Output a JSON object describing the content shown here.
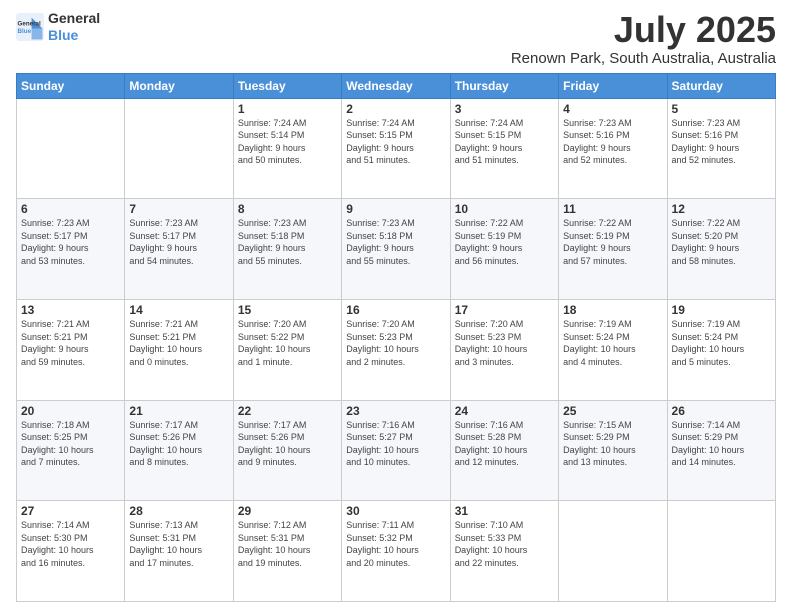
{
  "logo": {
    "line1": "General",
    "line2": "Blue"
  },
  "title": "July 2025",
  "subtitle": "Renown Park, South Australia, Australia",
  "days_of_week": [
    "Sunday",
    "Monday",
    "Tuesday",
    "Wednesday",
    "Thursday",
    "Friday",
    "Saturday"
  ],
  "weeks": [
    [
      {
        "day": "",
        "info": ""
      },
      {
        "day": "",
        "info": ""
      },
      {
        "day": "1",
        "info": "Sunrise: 7:24 AM\nSunset: 5:14 PM\nDaylight: 9 hours\nand 50 minutes."
      },
      {
        "day": "2",
        "info": "Sunrise: 7:24 AM\nSunset: 5:15 PM\nDaylight: 9 hours\nand 51 minutes."
      },
      {
        "day": "3",
        "info": "Sunrise: 7:24 AM\nSunset: 5:15 PM\nDaylight: 9 hours\nand 51 minutes."
      },
      {
        "day": "4",
        "info": "Sunrise: 7:23 AM\nSunset: 5:16 PM\nDaylight: 9 hours\nand 52 minutes."
      },
      {
        "day": "5",
        "info": "Sunrise: 7:23 AM\nSunset: 5:16 PM\nDaylight: 9 hours\nand 52 minutes."
      }
    ],
    [
      {
        "day": "6",
        "info": "Sunrise: 7:23 AM\nSunset: 5:17 PM\nDaylight: 9 hours\nand 53 minutes."
      },
      {
        "day": "7",
        "info": "Sunrise: 7:23 AM\nSunset: 5:17 PM\nDaylight: 9 hours\nand 54 minutes."
      },
      {
        "day": "8",
        "info": "Sunrise: 7:23 AM\nSunset: 5:18 PM\nDaylight: 9 hours\nand 55 minutes."
      },
      {
        "day": "9",
        "info": "Sunrise: 7:23 AM\nSunset: 5:18 PM\nDaylight: 9 hours\nand 55 minutes."
      },
      {
        "day": "10",
        "info": "Sunrise: 7:22 AM\nSunset: 5:19 PM\nDaylight: 9 hours\nand 56 minutes."
      },
      {
        "day": "11",
        "info": "Sunrise: 7:22 AM\nSunset: 5:19 PM\nDaylight: 9 hours\nand 57 minutes."
      },
      {
        "day": "12",
        "info": "Sunrise: 7:22 AM\nSunset: 5:20 PM\nDaylight: 9 hours\nand 58 minutes."
      }
    ],
    [
      {
        "day": "13",
        "info": "Sunrise: 7:21 AM\nSunset: 5:21 PM\nDaylight: 9 hours\nand 59 minutes."
      },
      {
        "day": "14",
        "info": "Sunrise: 7:21 AM\nSunset: 5:21 PM\nDaylight: 10 hours\nand 0 minutes."
      },
      {
        "day": "15",
        "info": "Sunrise: 7:20 AM\nSunset: 5:22 PM\nDaylight: 10 hours\nand 1 minute."
      },
      {
        "day": "16",
        "info": "Sunrise: 7:20 AM\nSunset: 5:23 PM\nDaylight: 10 hours\nand 2 minutes."
      },
      {
        "day": "17",
        "info": "Sunrise: 7:20 AM\nSunset: 5:23 PM\nDaylight: 10 hours\nand 3 minutes."
      },
      {
        "day": "18",
        "info": "Sunrise: 7:19 AM\nSunset: 5:24 PM\nDaylight: 10 hours\nand 4 minutes."
      },
      {
        "day": "19",
        "info": "Sunrise: 7:19 AM\nSunset: 5:24 PM\nDaylight: 10 hours\nand 5 minutes."
      }
    ],
    [
      {
        "day": "20",
        "info": "Sunrise: 7:18 AM\nSunset: 5:25 PM\nDaylight: 10 hours\nand 7 minutes."
      },
      {
        "day": "21",
        "info": "Sunrise: 7:17 AM\nSunset: 5:26 PM\nDaylight: 10 hours\nand 8 minutes."
      },
      {
        "day": "22",
        "info": "Sunrise: 7:17 AM\nSunset: 5:26 PM\nDaylight: 10 hours\nand 9 minutes."
      },
      {
        "day": "23",
        "info": "Sunrise: 7:16 AM\nSunset: 5:27 PM\nDaylight: 10 hours\nand 10 minutes."
      },
      {
        "day": "24",
        "info": "Sunrise: 7:16 AM\nSunset: 5:28 PM\nDaylight: 10 hours\nand 12 minutes."
      },
      {
        "day": "25",
        "info": "Sunrise: 7:15 AM\nSunset: 5:29 PM\nDaylight: 10 hours\nand 13 minutes."
      },
      {
        "day": "26",
        "info": "Sunrise: 7:14 AM\nSunset: 5:29 PM\nDaylight: 10 hours\nand 14 minutes."
      }
    ],
    [
      {
        "day": "27",
        "info": "Sunrise: 7:14 AM\nSunset: 5:30 PM\nDaylight: 10 hours\nand 16 minutes."
      },
      {
        "day": "28",
        "info": "Sunrise: 7:13 AM\nSunset: 5:31 PM\nDaylight: 10 hours\nand 17 minutes."
      },
      {
        "day": "29",
        "info": "Sunrise: 7:12 AM\nSunset: 5:31 PM\nDaylight: 10 hours\nand 19 minutes."
      },
      {
        "day": "30",
        "info": "Sunrise: 7:11 AM\nSunset: 5:32 PM\nDaylight: 10 hours\nand 20 minutes."
      },
      {
        "day": "31",
        "info": "Sunrise: 7:10 AM\nSunset: 5:33 PM\nDaylight: 10 hours\nand 22 minutes."
      },
      {
        "day": "",
        "info": ""
      },
      {
        "day": "",
        "info": ""
      }
    ]
  ]
}
